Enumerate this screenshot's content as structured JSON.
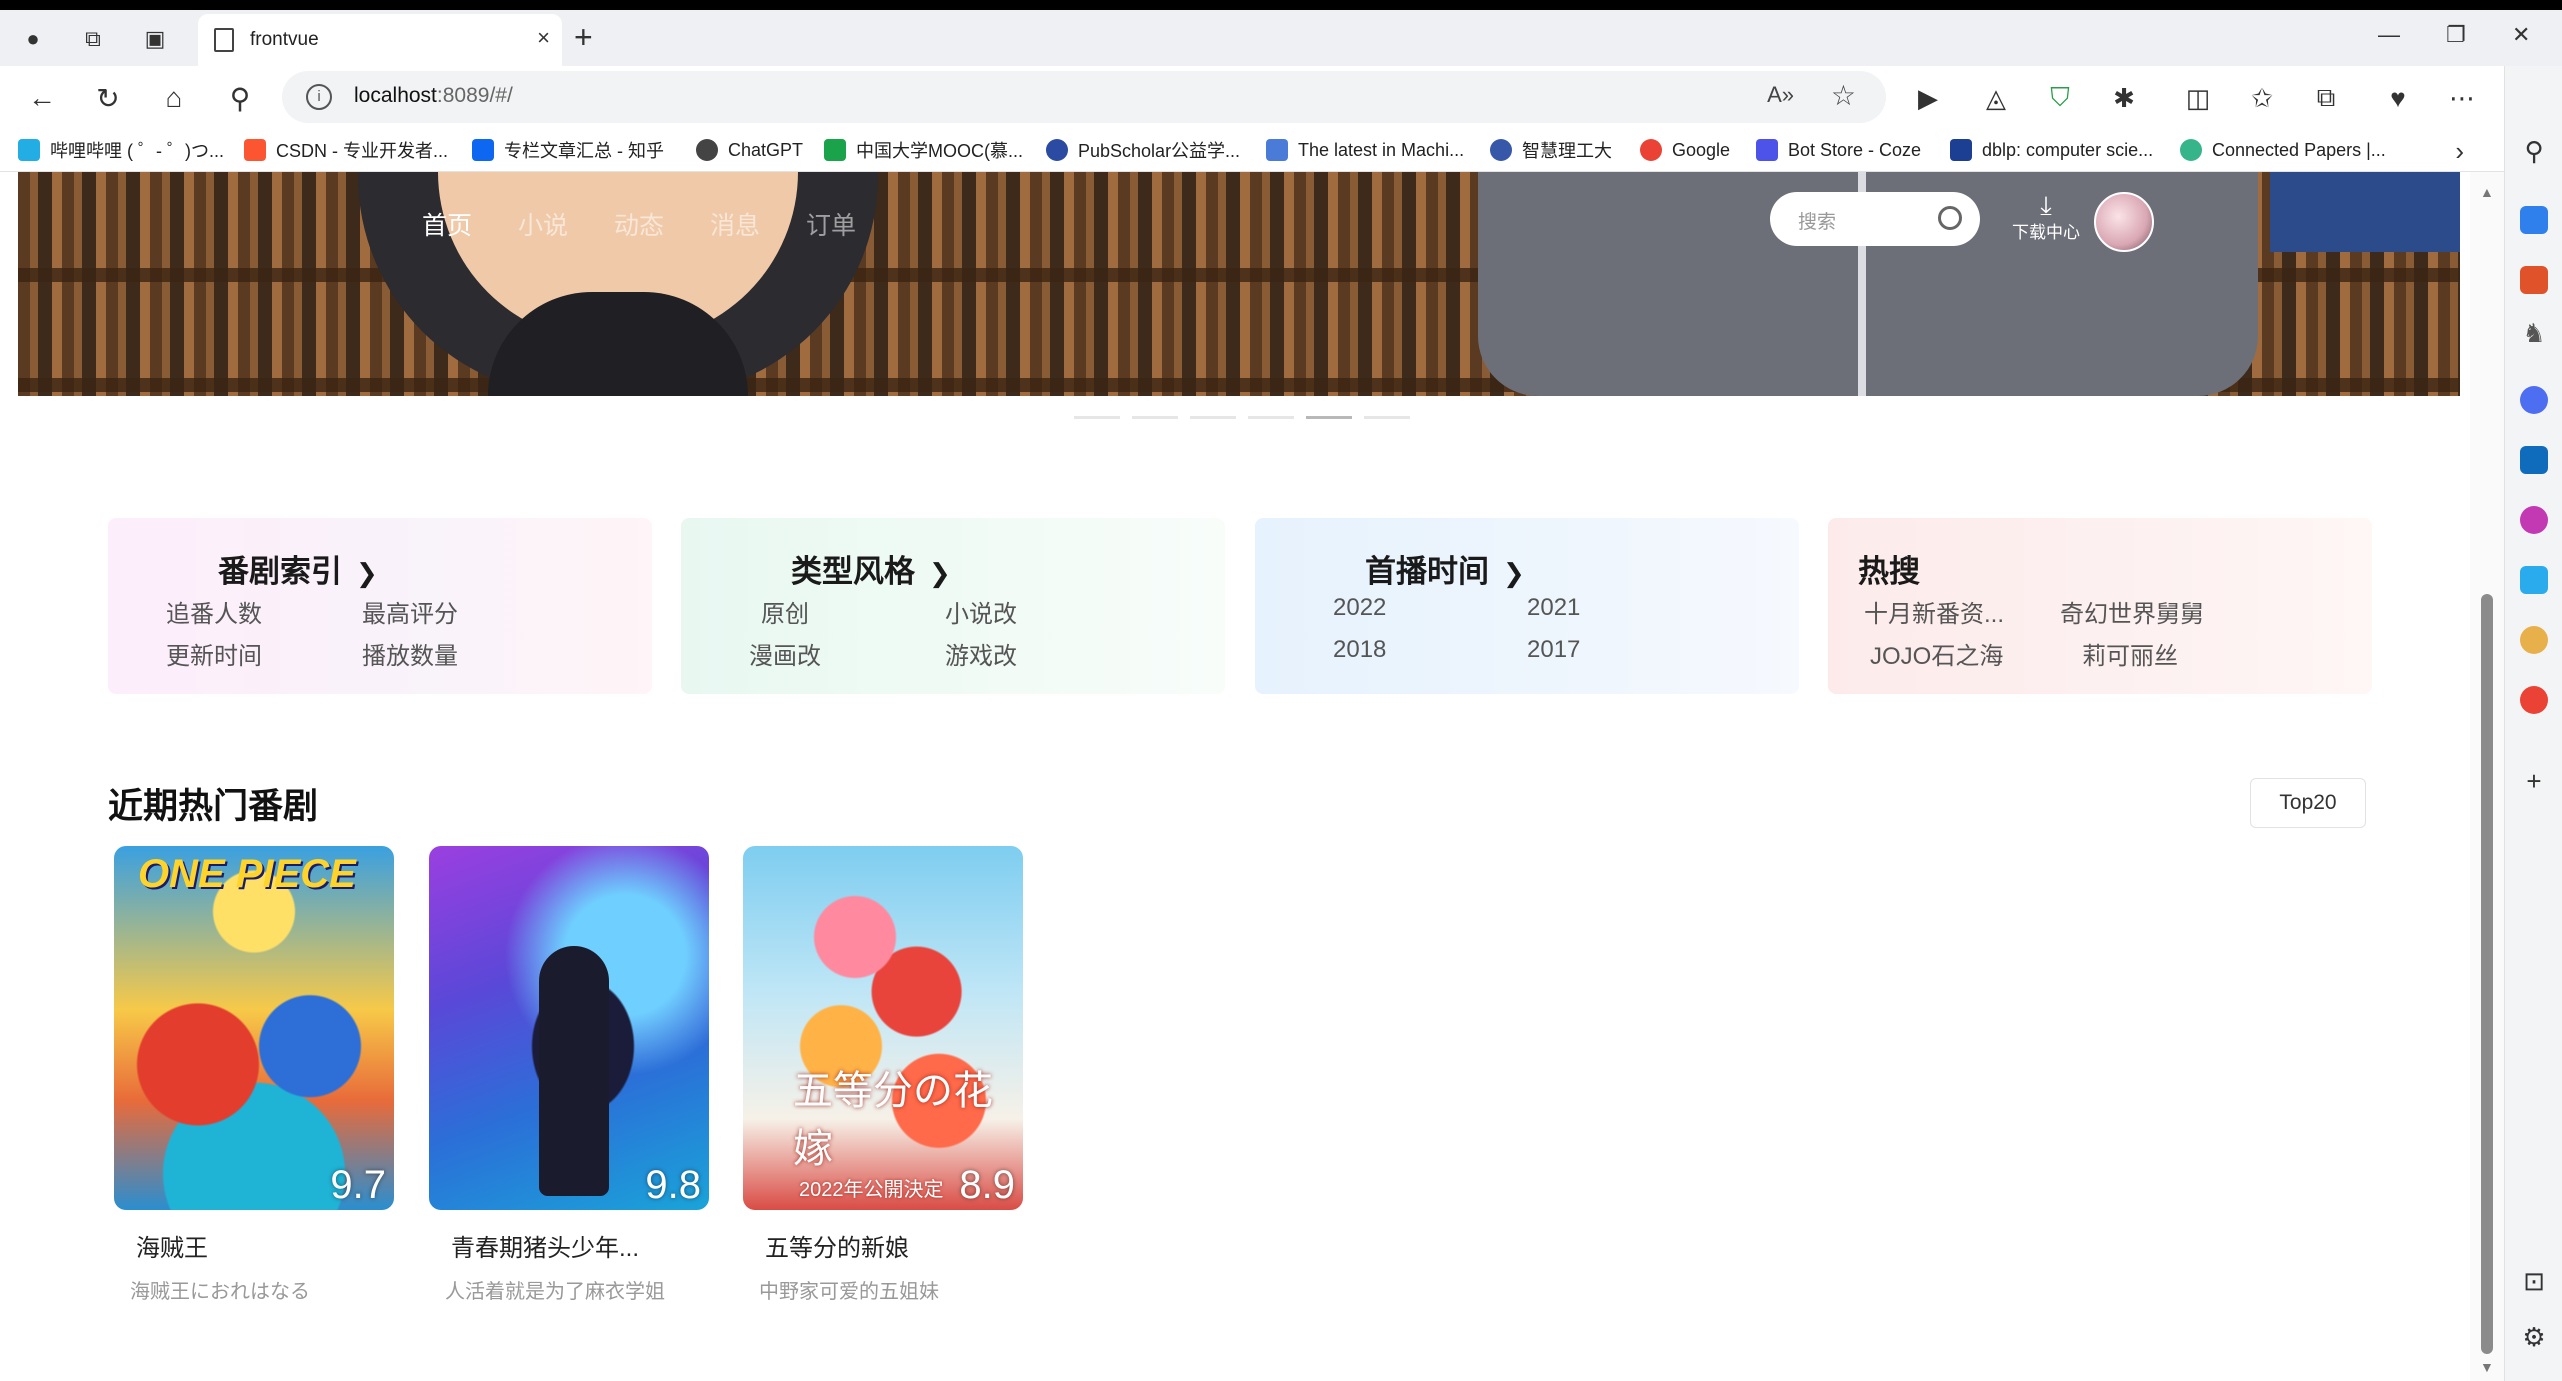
{
  "browser": {
    "tab_title": "frontvue",
    "url_host": "localhost",
    "url_rest": ":8089/#/",
    "new_tab": "+",
    "close_tab": "×"
  },
  "bookmarks": [
    {
      "label": "哔哩哔哩 ( ゜- ゜)つ...",
      "color": "#23ade5"
    },
    {
      "label": "CSDN - 专业开发者...",
      "color": "#fc5531"
    },
    {
      "label": "专栏文章汇总 - 知乎",
      "color": "#0d67f1"
    },
    {
      "label": "ChatGPT",
      "color": "#444444"
    },
    {
      "label": "中国大学MOOC(慕...",
      "color": "#1aa34a"
    },
    {
      "label": "PubScholar公益学...",
      "color": "#2b4ba2"
    },
    {
      "label": "The latest in Machi...",
      "color": "#4a7bd9"
    },
    {
      "label": "智慧理工大",
      "color": "#3757a8"
    },
    {
      "label": "Google",
      "color": "#ea4335"
    },
    {
      "label": "Bot Store - Coze",
      "color": "#4d53e8"
    },
    {
      "label": "dblp: computer scie...",
      "color": "#1c3f94"
    },
    {
      "label": "Connected Papers |...",
      "color": "#36b58b"
    }
  ],
  "site": {
    "nav": [
      "首页",
      "小说",
      "动态",
      "消息",
      "订单"
    ],
    "search_placeholder": "搜索",
    "download_label": "下载中心"
  },
  "categories": [
    {
      "title": "番剧索引",
      "has_arrow": true,
      "options": [
        "追番人数",
        "最高评分",
        "更新时间",
        "播放数量"
      ]
    },
    {
      "title": "类型风格",
      "has_arrow": true,
      "options": [
        "原创",
        "小说改",
        "漫画改",
        "游戏改"
      ]
    },
    {
      "title": "首播时间",
      "has_arrow": true,
      "options": [
        "2022",
        "2021",
        "2018",
        "2017"
      ]
    },
    {
      "title": "热搜",
      "has_arrow": false,
      "options": [
        "十月新番资...",
        "奇幻世界舅舅",
        "JOJO石之海",
        "莉可丽丝"
      ]
    }
  ],
  "hot": {
    "title": "近期热门番剧",
    "rank_button": "Top20",
    "items": [
      {
        "name": "海贼王",
        "subtitle": "海贼王におれはなる",
        "score": "9.7",
        "poster_text": "ONE PIECE"
      },
      {
        "name": "青春期猪头少年...",
        "subtitle": "人活着就是为了麻衣学姐",
        "score": "9.8",
        "poster_text": ""
      },
      {
        "name": "五等分的新娘",
        "subtitle": "中野家可爱的五姐妹",
        "score": "8.9",
        "poster_text": "五等分の花嫁",
        "poster_text2": "2022年公開決定"
      }
    ]
  }
}
